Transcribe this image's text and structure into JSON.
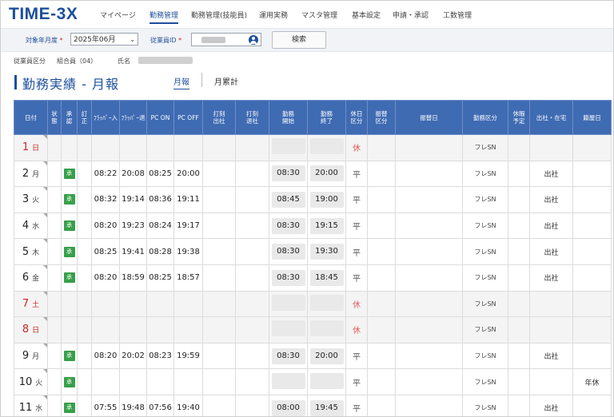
{
  "app": {
    "logo": "TIME-3X"
  },
  "nav": {
    "items": [
      {
        "label": "マイページ",
        "active": false
      },
      {
        "label": "勤務管理",
        "active": true
      },
      {
        "label": "勤務管理(技能員)",
        "active": false
      },
      {
        "label": "運用実務",
        "active": false
      },
      {
        "label": "マスタ管理",
        "active": false
      },
      {
        "label": "基本設定",
        "active": false
      },
      {
        "label": "申請・承認",
        "active": false
      },
      {
        "label": "工数管理",
        "active": false
      }
    ]
  },
  "search": {
    "month_label": "対象年月度",
    "required_mark": "*",
    "month_value": "2025年06月",
    "employee_label": "従業員ID",
    "button_label": "検索"
  },
  "info": {
    "category_label": "従業員区分",
    "category_value": "組合員（04）",
    "name_label": "氏名"
  },
  "page": {
    "title": "勤務実績 - 月報",
    "tabs": [
      {
        "label": "月報",
        "active": true
      },
      {
        "label": "月累計",
        "active": false
      }
    ]
  },
  "table": {
    "headers": [
      {
        "key": "date",
        "label": "日付"
      },
      {
        "key": "status",
        "label": "状\n態"
      },
      {
        "key": "approve",
        "label": "承\n認"
      },
      {
        "key": "correct",
        "label": "訂\n正"
      },
      {
        "key": "flapper_in",
        "label": "ﾌﾗｯﾊﾟｰ入"
      },
      {
        "key": "flapper_out",
        "label": "ﾌﾗｯﾊﾟｰ退"
      },
      {
        "key": "pc_on",
        "label": "PC ON"
      },
      {
        "key": "pc_off",
        "label": "PC OFF"
      },
      {
        "key": "stamp_in",
        "label": "打刻\n出社"
      },
      {
        "key": "stamp_out",
        "label": "打刻\n退社"
      },
      {
        "key": "work_start",
        "label": "勤務\n開始"
      },
      {
        "key": "work_end",
        "label": "勤務\n終了"
      },
      {
        "key": "holiday_div",
        "label": "休日\n区分"
      },
      {
        "key": "transfer_div",
        "label": "振替\n区分"
      },
      {
        "key": "transfer_day",
        "label": "振替日"
      },
      {
        "key": "work_div",
        "label": "勤務区分"
      },
      {
        "key": "leave_plan",
        "label": "休暇\n予定"
      },
      {
        "key": "location",
        "label": "出社・在宅"
      },
      {
        "key": "extra",
        "label": "籍屋日"
      }
    ],
    "rows": [
      {
        "day": "1",
        "dow": "日",
        "off": true,
        "approved": false,
        "badge": "",
        "fin": "",
        "fout": "",
        "pon": "",
        "poff": "",
        "ws": "",
        "we": "",
        "holiday": "休",
        "work_div": "フレSN",
        "loc": "",
        "extra": ""
      },
      {
        "day": "2",
        "dow": "月",
        "off": false,
        "approved": true,
        "badge": "承",
        "fin": "08:22",
        "fout": "20:08",
        "pon": "08:25",
        "poff": "20:00",
        "ws": "08:30",
        "we": "20:00",
        "holiday": "平",
        "work_div": "フレSN",
        "loc": "出社",
        "extra": ""
      },
      {
        "day": "3",
        "dow": "火",
        "off": false,
        "approved": true,
        "badge": "承",
        "fin": "08:32",
        "fout": "19:14",
        "pon": "08:36",
        "poff": "19:11",
        "ws": "08:45",
        "we": "19:00",
        "holiday": "平",
        "work_div": "フレSN",
        "loc": "出社",
        "extra": ""
      },
      {
        "day": "4",
        "dow": "水",
        "off": false,
        "approved": true,
        "badge": "承",
        "fin": "08:20",
        "fout": "19:23",
        "pon": "08:24",
        "poff": "19:17",
        "ws": "08:30",
        "we": "19:15",
        "holiday": "平",
        "work_div": "フレSN",
        "loc": "出社",
        "extra": ""
      },
      {
        "day": "5",
        "dow": "木",
        "off": false,
        "approved": true,
        "badge": "承",
        "fin": "08:25",
        "fout": "19:41",
        "pon": "08:28",
        "poff": "19:38",
        "ws": "08:30",
        "we": "19:30",
        "holiday": "平",
        "work_div": "フレSN",
        "loc": "出社",
        "extra": ""
      },
      {
        "day": "6",
        "dow": "金",
        "off": false,
        "approved": true,
        "badge": "承",
        "fin": "08:20",
        "fout": "18:59",
        "pon": "08:25",
        "poff": "18:57",
        "ws": "08:30",
        "we": "18:45",
        "holiday": "平",
        "work_div": "フレSN",
        "loc": "出社",
        "extra": ""
      },
      {
        "day": "7",
        "dow": "土",
        "off": true,
        "approved": false,
        "badge": "",
        "fin": "",
        "fout": "",
        "pon": "",
        "poff": "",
        "ws": "",
        "we": "",
        "holiday": "休",
        "work_div": "フレSN",
        "loc": "",
        "extra": ""
      },
      {
        "day": "8",
        "dow": "日",
        "off": true,
        "approved": false,
        "badge": "",
        "fin": "",
        "fout": "",
        "pon": "",
        "poff": "",
        "ws": "",
        "we": "",
        "holiday": "休",
        "work_div": "フレSN",
        "loc": "",
        "extra": ""
      },
      {
        "day": "9",
        "dow": "月",
        "off": false,
        "approved": true,
        "badge": "承",
        "fin": "08:20",
        "fout": "20:02",
        "pon": "08:23",
        "poff": "19:59",
        "ws": "08:30",
        "we": "20:00",
        "holiday": "平",
        "work_div": "フレSN",
        "loc": "出社",
        "extra": ""
      },
      {
        "day": "10",
        "dow": "火",
        "off": false,
        "approved": true,
        "badge": "承",
        "fin": "",
        "fout": "",
        "pon": "",
        "poff": "",
        "ws": "",
        "we": "",
        "holiday": "平",
        "work_div": "フレSN",
        "loc": "",
        "extra": "年休"
      },
      {
        "day": "11",
        "dow": "水",
        "off": false,
        "approved": true,
        "badge": "承",
        "fin": "07:55",
        "fout": "19:48",
        "pon": "07:56",
        "poff": "19:40",
        "ws": "08:00",
        "we": "19:45",
        "holiday": "平",
        "work_div": "フレSN",
        "loc": "出社",
        "extra": ""
      }
    ]
  }
}
